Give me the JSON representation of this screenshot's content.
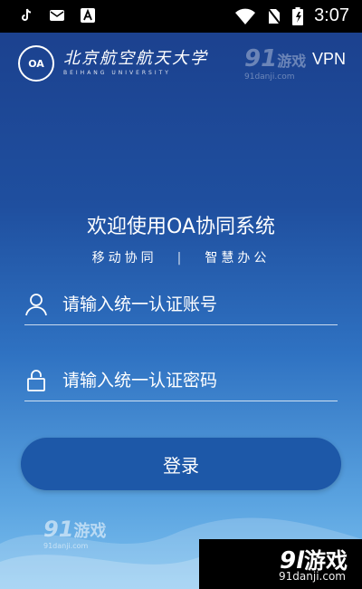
{
  "status_bar": {
    "time": "3:07",
    "icons": [
      "tiktok-icon",
      "mail-icon",
      "font-icon",
      "wifi-icon",
      "no-sim-icon",
      "battery-icon"
    ]
  },
  "header": {
    "university_cn": "北京航空航天大学",
    "university_en": "BEIHANG UNIVERSITY",
    "seal_text": "OA",
    "vpn_label": "VPN"
  },
  "watermarks": {
    "top_big": "91",
    "top_text": "游戏",
    "top_url": "91danji.com",
    "bottom_left_big": "91",
    "bottom_left_text": "游戏",
    "bottom_left_url": "91danji.com",
    "bottom_right_big": "9l",
    "bottom_right_text": "游戏",
    "bottom_right_url": "91danji.com"
  },
  "welcome": {
    "title": "欢迎使用OA协同系统",
    "subtitle_left": "移动协同",
    "subtitle_sep": "|",
    "subtitle_right": "智慧办公"
  },
  "form": {
    "username_placeholder": "请输入统一认证账号",
    "password_placeholder": "请输入统一认证密码",
    "login_label": "登录"
  },
  "colors": {
    "bg_top": "#1b3f8c",
    "bg_bottom": "#7cc0ef",
    "button": "#1d58a8"
  }
}
